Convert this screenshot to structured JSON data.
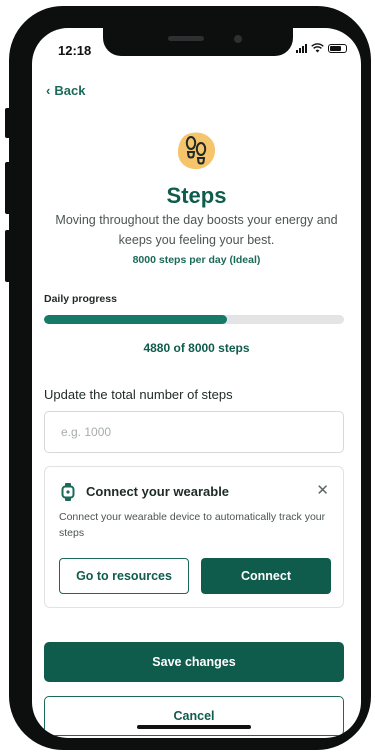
{
  "status_bar": {
    "time": "12:18"
  },
  "nav": {
    "back_label": "Back"
  },
  "header": {
    "title": "Steps",
    "description": "Moving throughout the day boosts your energy and keeps you feeling your best.",
    "ideal": "8000 steps per day (Ideal)",
    "icon": "footprints-icon"
  },
  "progress": {
    "label": "Daily progress",
    "current": 4880,
    "goal": 8000,
    "text": "4880 of 8000 steps",
    "color": "#177a68"
  },
  "update": {
    "label": "Update the total number of steps",
    "placeholder": "e.g. 1000",
    "value": ""
  },
  "wearable_card": {
    "icon": "watch-icon",
    "title": "Connect your wearable",
    "text": "Connect your wearable device to automatically track your steps",
    "resources_label": "Go to resources",
    "connect_label": "Connect"
  },
  "actions": {
    "save_label": "Save changes",
    "cancel_label": "Cancel"
  },
  "colors": {
    "brand": "#0f5c4d",
    "accent": "#f6c46a"
  }
}
